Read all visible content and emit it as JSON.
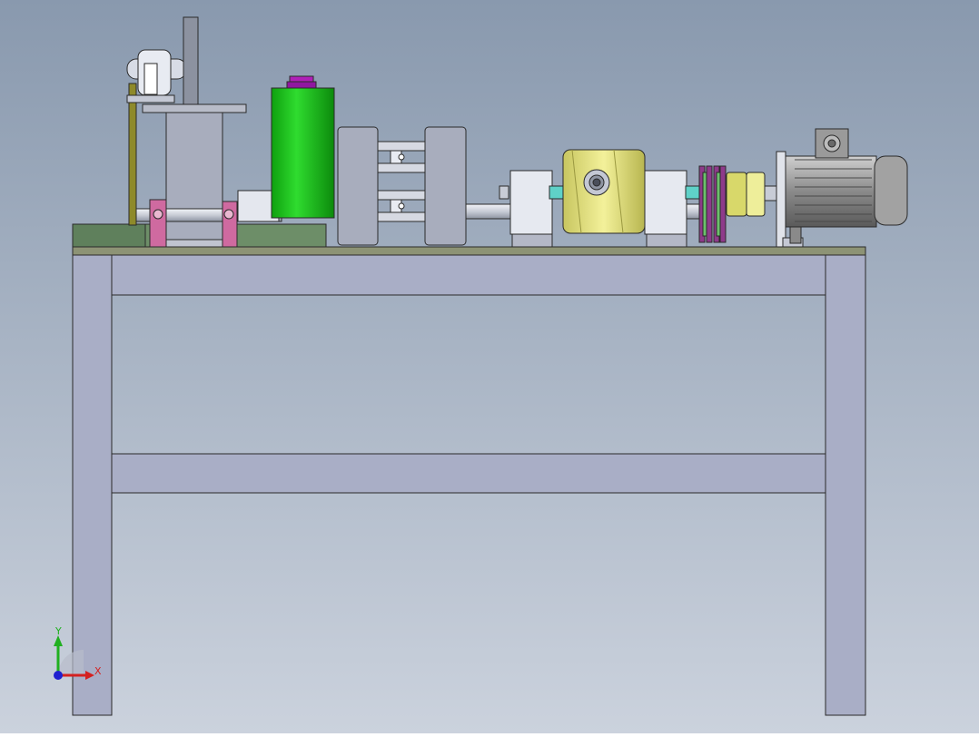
{
  "triad": {
    "x_label": "X",
    "y_label": "Y"
  },
  "colors": {
    "bg_top": "#8a9bb0",
    "bg_bottom": "#c9d1dc",
    "frame": "#a9aec8",
    "table_top": "#8a9272",
    "base_plate": "#6f8f6a",
    "cylinder": "#1fc61f",
    "cylinder_cap": "#a018a8",
    "pink_block": "#cc6699",
    "worm_gear": "#e4e27a",
    "motor": "#9a9a9a",
    "axis_x": "#d42020",
    "axis_y": "#20b020",
    "axis_z": "#2020d0"
  }
}
